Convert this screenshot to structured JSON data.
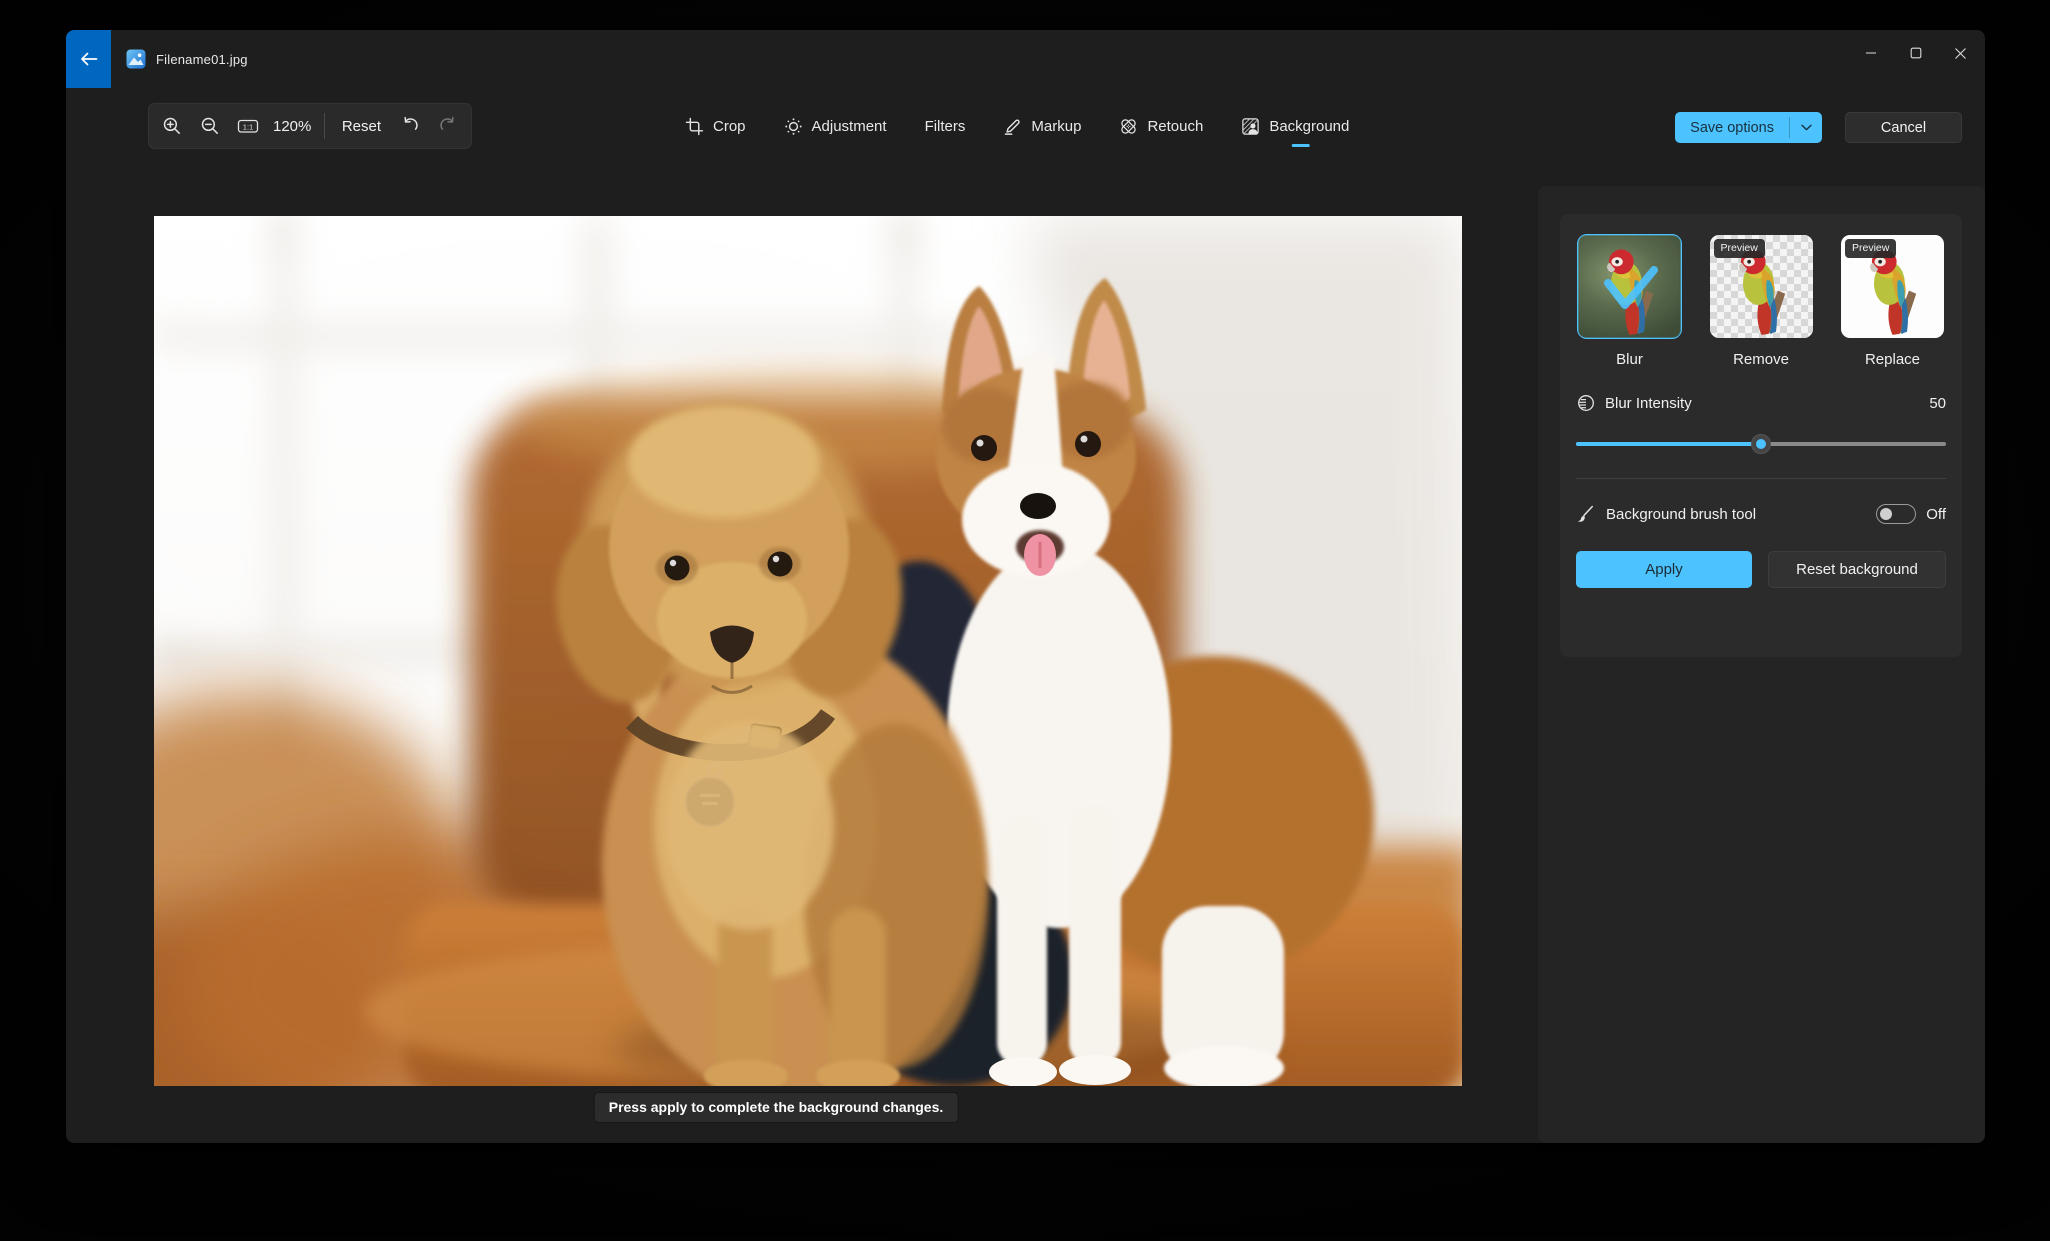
{
  "window": {
    "title": "Filename01.jpg"
  },
  "toolbar": {
    "zoom_level": "120%",
    "reset_label": "Reset"
  },
  "tabs": [
    {
      "label": "Crop",
      "active": false
    },
    {
      "label": "Adjustment",
      "active": false
    },
    {
      "label": "Filters",
      "active": false
    },
    {
      "label": "Markup",
      "active": false
    },
    {
      "label": "Retouch",
      "active": false
    },
    {
      "label": "Background",
      "active": true
    }
  ],
  "actions": {
    "save_options_label": "Save options",
    "cancel_label": "Cancel"
  },
  "background_panel": {
    "modes": [
      {
        "label": "Blur",
        "selected": true,
        "preview_badge": false
      },
      {
        "label": "Remove",
        "selected": false,
        "preview_badge": true
      },
      {
        "label": "Replace",
        "selected": false,
        "preview_badge": true
      }
    ],
    "preview_badge_label": "Preview",
    "blur_intensity": {
      "label": "Blur Intensity",
      "value": "50"
    },
    "brush": {
      "label": "Background brush tool",
      "state": "Off"
    },
    "apply_label": "Apply",
    "reset_background_label": "Reset background"
  },
  "status_tooltip": "Press apply to complete the background changes.",
  "icons": {
    "titlebar": [
      "back-arrow",
      "photos-app",
      "minimize",
      "maximize",
      "close"
    ],
    "toolbar": [
      "zoom-in",
      "zoom-out",
      "actual-size-1-1",
      "undo",
      "redo"
    ],
    "tabs": [
      "crop",
      "adjustment-sun",
      "markup-pencil",
      "retouch-bandage",
      "background-person"
    ],
    "panel": [
      "contrast-half-circle",
      "brush"
    ]
  },
  "colors": {
    "accent": "#4CC2FF",
    "accent_text": "#1C2B33",
    "back_button": "#0067C0",
    "window_bg": "#1E1E1E",
    "panel_bg": "#242424",
    "card_bg": "#2B2B2B"
  }
}
